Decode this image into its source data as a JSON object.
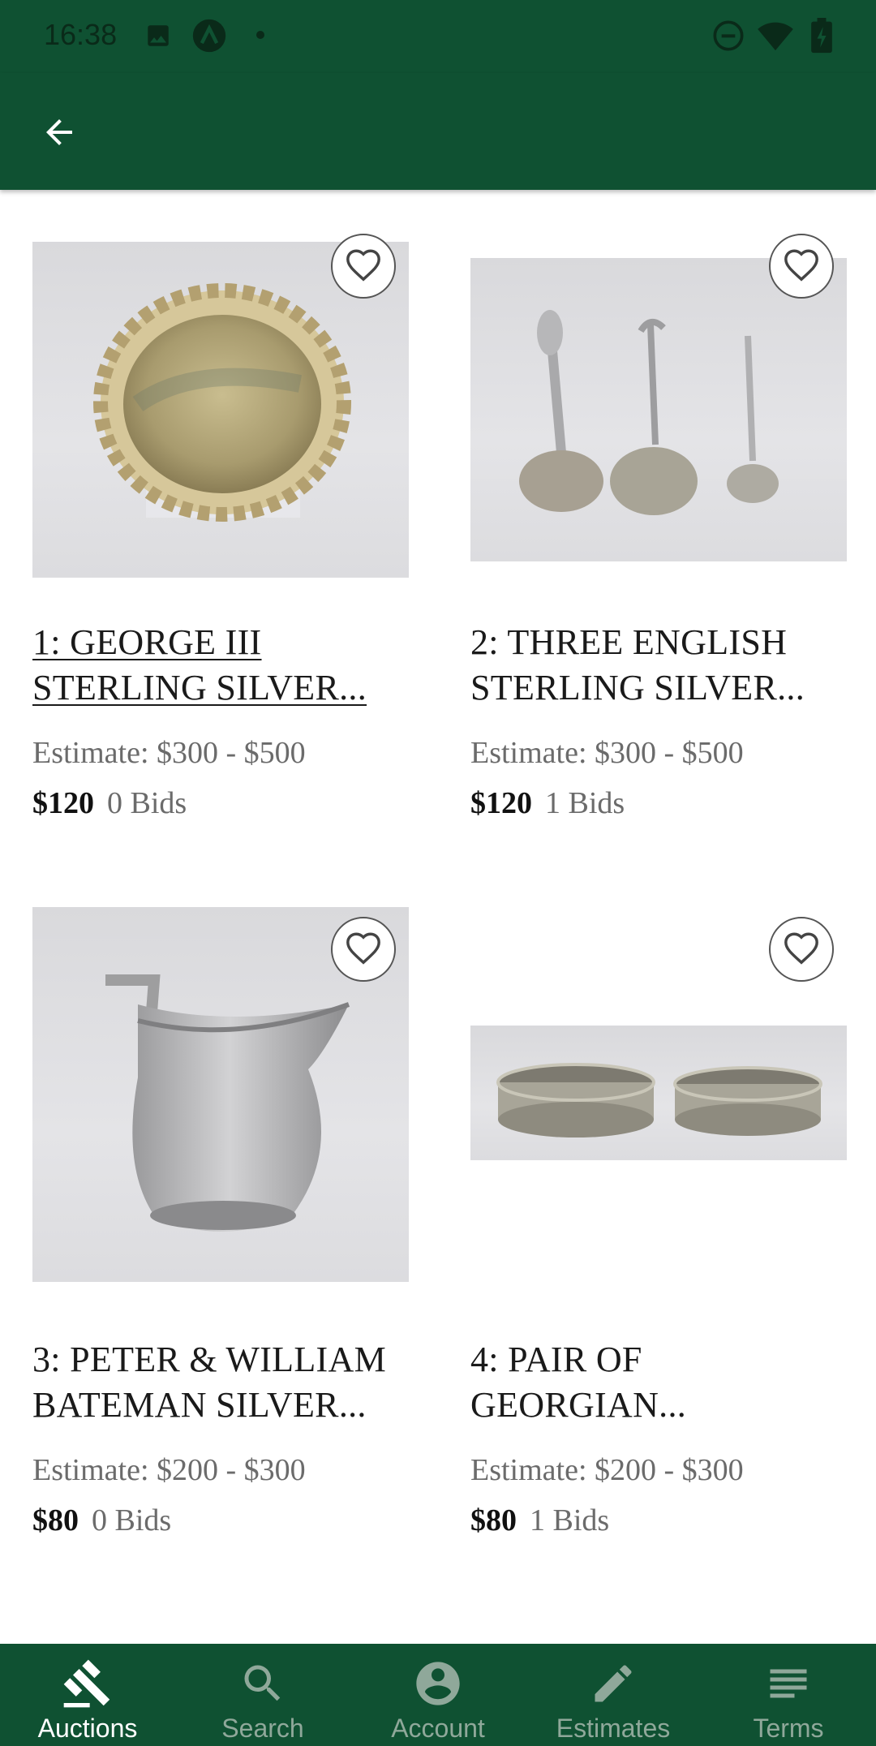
{
  "status_bar": {
    "time": "16:38",
    "left_icons": [
      "image-icon",
      "app-a-icon",
      "dot-icon"
    ],
    "right_icons": [
      "dnd-icon",
      "wifi-icon",
      "battery-icon"
    ]
  },
  "app_bar": {
    "back_icon": "arrow-back-icon"
  },
  "lots": [
    {
      "title": "1: GEORGE III STERLING SILVER...",
      "estimate": "Estimate: $300 - $500",
      "price": "$120",
      "bids": "0 Bids",
      "image": "silver-salver"
    },
    {
      "title": "2: THREE ENGLISH STERLING SILVER...",
      "estimate": "Estimate: $300 - $500",
      "price": "$120",
      "bids": "1 Bids",
      "image": "silver-ladles"
    },
    {
      "title": "3: PETER & WILLIAM BATEMAN SILVER...",
      "estimate": "Estimate: $200 - $300",
      "price": "$80",
      "bids": "0 Bids",
      "image": "silver-cream-jug"
    },
    {
      "title": "4: PAIR OF GEORGIAN...",
      "estimate": "Estimate: $200 - $300",
      "price": "$80",
      "bids": "1 Bids",
      "image": "wine-coasters"
    }
  ],
  "bottom_nav": {
    "items": [
      {
        "label": "Auctions",
        "icon": "gavel-icon",
        "active": true
      },
      {
        "label": "Search",
        "icon": "search-icon",
        "active": false
      },
      {
        "label": "Account",
        "icon": "account-icon",
        "active": false
      },
      {
        "label": "Estimates",
        "icon": "pencil-icon",
        "active": false
      },
      {
        "label": "Terms",
        "icon": "list-icon",
        "active": false
      }
    ]
  },
  "colors": {
    "brand_green": "#0f5132",
    "nav_inactive": "#8fa89a"
  }
}
